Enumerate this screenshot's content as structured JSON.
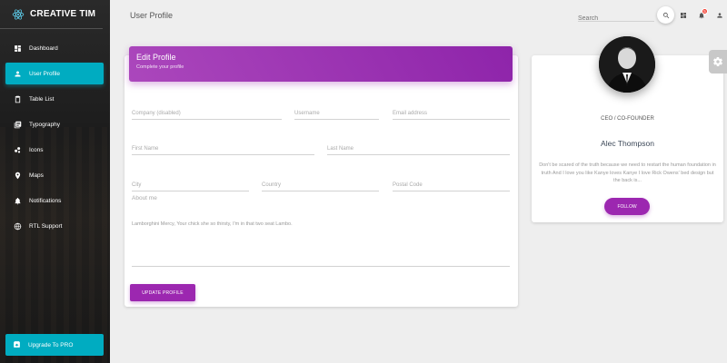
{
  "brand": {
    "name": "CREATIVE TIM"
  },
  "sidebar": {
    "items": [
      {
        "label": "Dashboard",
        "icon": "dashboard-icon"
      },
      {
        "label": "User Profile",
        "icon": "person-icon",
        "active": true
      },
      {
        "label": "Table List",
        "icon": "clipboard-icon"
      },
      {
        "label": "Typography",
        "icon": "library-books-icon"
      },
      {
        "label": "Icons",
        "icon": "bubble-chart-icon"
      },
      {
        "label": "Maps",
        "icon": "location-icon"
      },
      {
        "label": "Notifications",
        "icon": "bell-icon"
      },
      {
        "label": "RTL Support",
        "icon": "language-icon"
      }
    ],
    "upgrade": {
      "label": "Upgrade To PRO",
      "icon": "unarchive-icon"
    }
  },
  "header": {
    "title": "User Profile",
    "search_placeholder": "Search",
    "notification_count": "5"
  },
  "edit_profile": {
    "title": "Edit Profile",
    "subtitle": "Complete your profile",
    "fields": {
      "company": "Company (disabled)",
      "username": "Username",
      "email": "Email address",
      "first_name": "First Name",
      "last_name": "Last Name",
      "city": "City",
      "country": "Country",
      "postal": "Postal Code"
    },
    "about_label": "About me",
    "about_text": "Lamborghini Mercy, Your chick she so thirsty, I'm in that two seat Lambo.",
    "button": "UPDATE PROFILE"
  },
  "profile": {
    "role": "CEO / CO-FOUNDER",
    "name": "Alec Thompson",
    "bio": "Don't be scared of the truth because we need to restart the human foundation in truth And I love you like Kanye loves Kanye I love Rick Owens' bed design but the back is...",
    "button": "FOLLOW"
  },
  "colors": {
    "accent": "#9c27b0",
    "active": "#00acc1",
    "badge": "#f44336"
  }
}
